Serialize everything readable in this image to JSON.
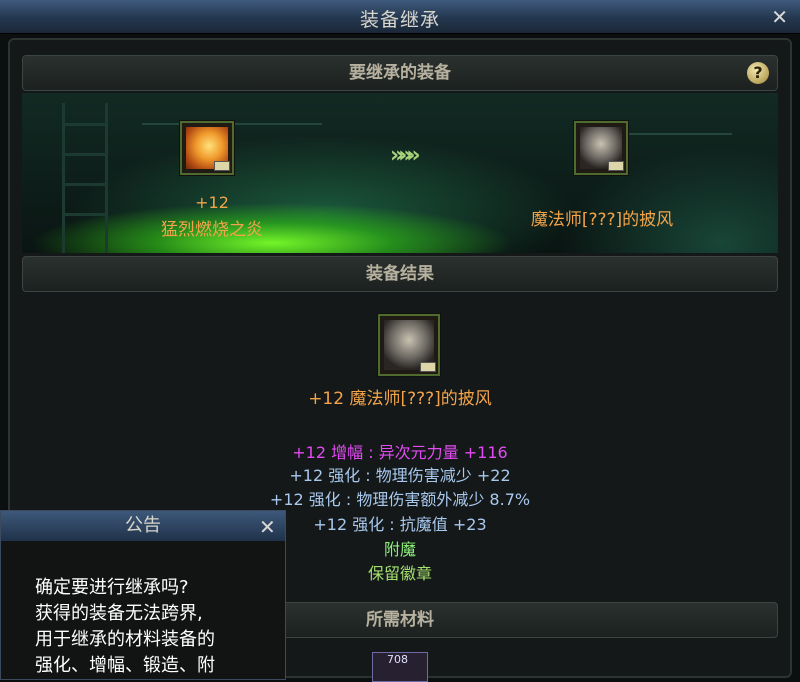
{
  "window": {
    "title": "装备继承"
  },
  "inherit_section": {
    "title": "要继承的装备",
    "help_label": "?"
  },
  "source_item": {
    "enhance": "+12",
    "name": "猛烈燃烧之炎",
    "icon": "flame-box-icon"
  },
  "target_item": {
    "name": "魔法师[???]的披风",
    "icon": "mage-cape-icon"
  },
  "transfer_arrows": "»»»",
  "result_section": {
    "title": "装备结果",
    "item_name": "+12  魔法师[???]的披风",
    "stats": [
      "+12  增幅 : 异次元力量  +116",
      "+12  强化 : 物理伤害减少  +22",
      "+12  强化 : 物理伤害额外减少  8.7%",
      "+12  强化 : 抗魔值  +23"
    ],
    "enchant": "附魔",
    "keep_emblem": "保留徽章"
  },
  "materials_section": {
    "title": "所需材料",
    "material_count": "708"
  },
  "notice": {
    "title": "公告",
    "lines": [
      "确定要进行继承吗?",
      "获得的装备无法跨界,",
      "用于继承的材料装备的",
      "强化、增幅、锻造、附"
    ]
  },
  "colors": {
    "title_bar": "#2c4260",
    "orange_text": "#f3a44a",
    "pink_text": "#e34af4",
    "blue_text": "#a8c8ee",
    "green_text": "#8ff07c"
  }
}
